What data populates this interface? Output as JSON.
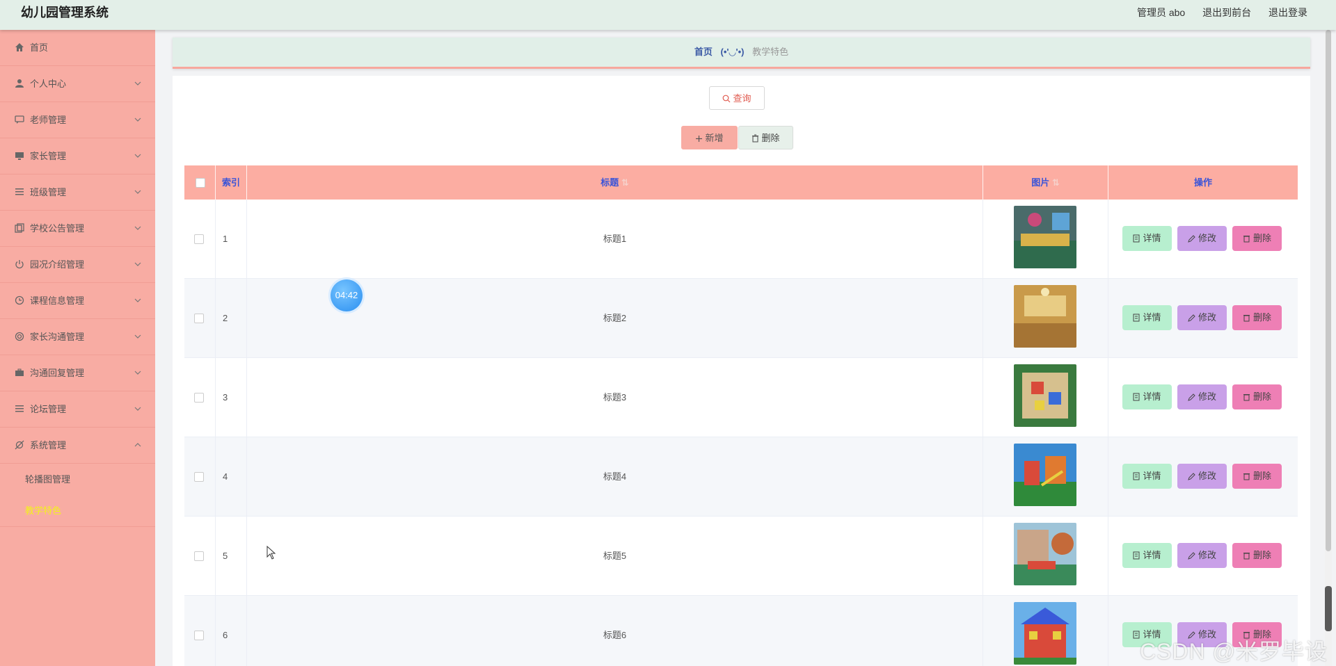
{
  "app": {
    "title": "幼儿园管理系统"
  },
  "header_links": {
    "admin": "管理员 abo",
    "to_front": "退出到前台",
    "logout": "退出登录"
  },
  "sidebar": {
    "items": [
      {
        "label": "首页",
        "icon": "home-icon"
      },
      {
        "label": "个人中心",
        "icon": "user-icon"
      },
      {
        "label": "老师管理",
        "icon": "chat-icon"
      },
      {
        "label": "家长管理",
        "icon": "monitor-icon"
      },
      {
        "label": "班级管理",
        "icon": "list-icon"
      },
      {
        "label": "学校公告管理",
        "icon": "copy-icon"
      },
      {
        "label": "园况介绍管理",
        "icon": "power-icon"
      },
      {
        "label": "课程信息管理",
        "icon": "clock-icon"
      },
      {
        "label": "家长沟通管理",
        "icon": "target-icon"
      },
      {
        "label": "沟通回复管理",
        "icon": "briefcase-icon"
      },
      {
        "label": "论坛管理",
        "icon": "menu-icon"
      },
      {
        "label": "系统管理",
        "icon": "settings-off-icon"
      }
    ],
    "sub_items": [
      {
        "label": "轮播图管理"
      },
      {
        "label": "教学特色"
      }
    ]
  },
  "breadcrumb": {
    "home": "首页",
    "sep": "(•'◡'•)",
    "current": "教学特色"
  },
  "toolbar": {
    "search_label": "查询",
    "add_label": "新增",
    "delete_label": "删除"
  },
  "table": {
    "headers": [
      "索引",
      "标题",
      "图片",
      "操作"
    ],
    "rows": [
      {
        "index": "1",
        "title": "标题1"
      },
      {
        "index": "2",
        "title": "标题2"
      },
      {
        "index": "3",
        "title": "标题3"
      },
      {
        "index": "4",
        "title": "标题4"
      },
      {
        "index": "5",
        "title": "标题5"
      },
      {
        "index": "6",
        "title": "标题6"
      }
    ],
    "actions": {
      "detail": "详情",
      "edit": "修改",
      "delete": "删除"
    }
  },
  "timer": "04:42",
  "watermark": "CSDN @米罗毕设",
  "colors": {
    "sidebar": "#f8aca3",
    "header": "#e3efe8",
    "table_header": "#fcada2",
    "active_submenu": "#f3f31a"
  }
}
